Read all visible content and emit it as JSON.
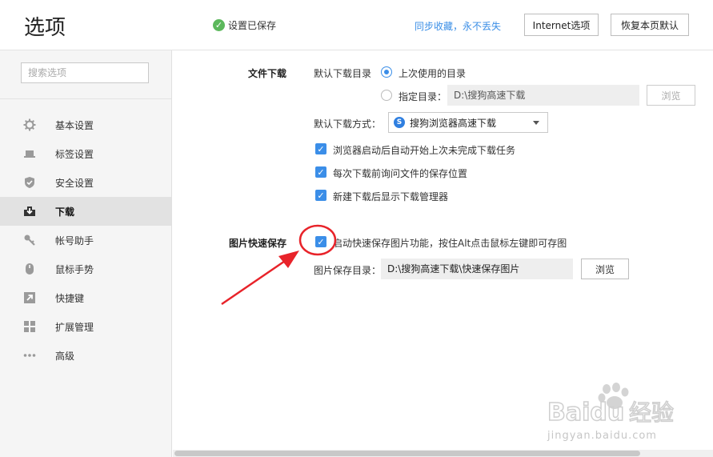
{
  "header": {
    "title": "选项",
    "saved_status": "设置已保存",
    "sync_link": "同步收藏，永不丢失",
    "internet_button": "Internet选项",
    "restore_button": "恢复本页默认"
  },
  "sidebar": {
    "search_placeholder": "搜索选项",
    "items": [
      {
        "label": "基本设置",
        "icon": "gear-icon"
      },
      {
        "label": "标签设置",
        "icon": "laptop-icon"
      },
      {
        "label": "安全设置",
        "icon": "shield-icon"
      },
      {
        "label": "下载",
        "icon": "download-icon",
        "active": true
      },
      {
        "label": "帐号助手",
        "icon": "key-icon"
      },
      {
        "label": "鼠标手势",
        "icon": "mouse-icon"
      },
      {
        "label": "快捷键",
        "icon": "shortcut-arrow-icon"
      },
      {
        "label": "扩展管理",
        "icon": "grid-icon"
      },
      {
        "label": "高级",
        "icon": "more-dots-icon"
      }
    ]
  },
  "download": {
    "section_title": "文件下载",
    "default_dir_label": "默认下载目录",
    "radio_last_used": "上次使用的目录",
    "radio_specified": "指定目录：",
    "specified_path": "D:\\搜狗高速下载",
    "browse_disabled": "浏览",
    "method_label": "默认下载方式：",
    "method_value": "搜狗浏览器高速下载",
    "options": [
      {
        "label": "浏览器启动后自动开始上次未完成下载任务",
        "checked": true
      },
      {
        "label": "每次下载前询问文件的保存位置",
        "checked": true
      },
      {
        "label": "新建下载后显示下载管理器",
        "checked": true
      }
    ]
  },
  "image_save": {
    "section_title": "图片快速保存",
    "enable_label": "启动快速保存图片功能，按住Alt点击鼠标左键即可存图",
    "enable_checked": true,
    "dir_label": "图片保存目录：",
    "dir_value": "D:\\搜狗高速下载\\快速保存图片",
    "browse_button": "浏览"
  },
  "colors": {
    "accent": "#3b8ee8",
    "annotation": "#e8232a",
    "link": "#3a8ee6",
    "saved_check": "#5cb85c"
  },
  "watermark": {
    "brand": "Baidu",
    "brand_cn": "经验",
    "url": "jingyan.baidu.com"
  }
}
